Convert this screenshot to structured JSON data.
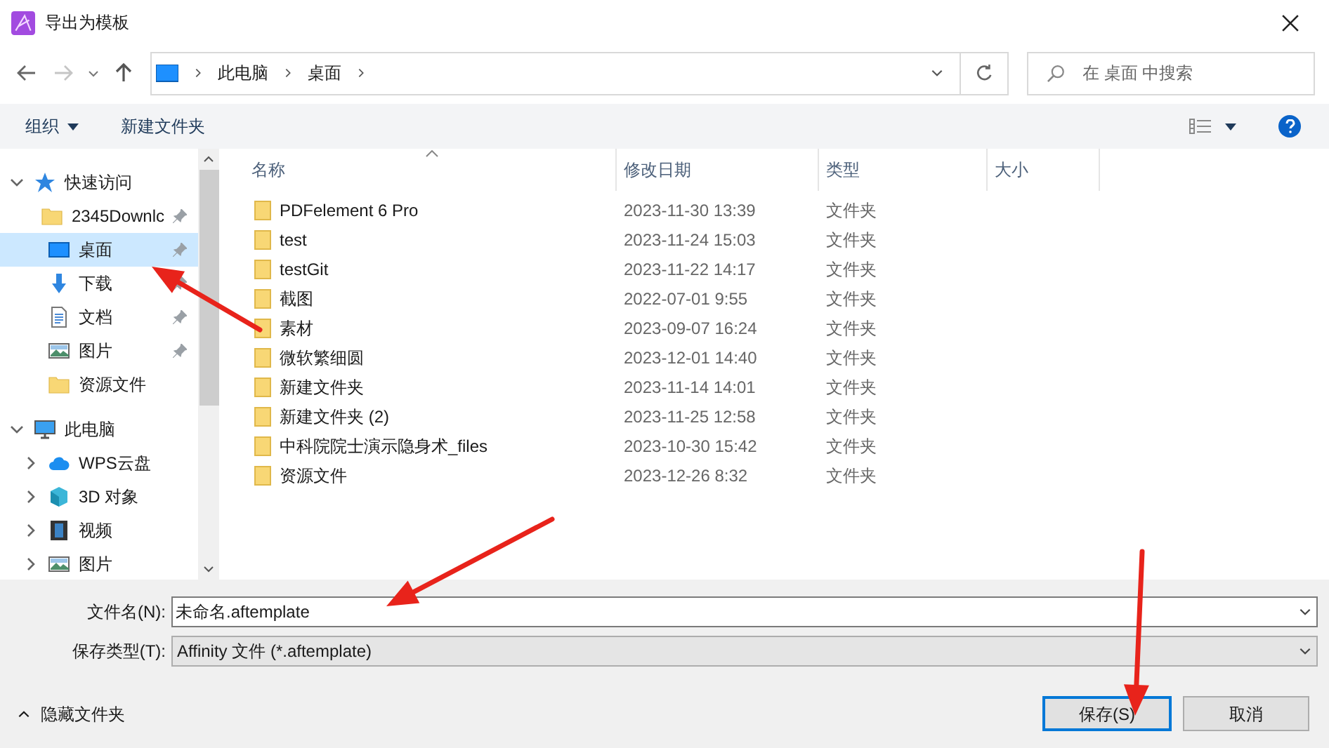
{
  "window": {
    "title": "导出为模板"
  },
  "address": {
    "crumbs": [
      "此电脑",
      "桌面"
    ]
  },
  "search": {
    "placeholder": "在 桌面 中搜索"
  },
  "toolbar": {
    "organize": "组织",
    "new_folder": "新建文件夹"
  },
  "sidebar": {
    "items": [
      {
        "label": "快速访问",
        "kind": "star",
        "expanded": true,
        "selected": false,
        "children": [
          {
            "label": "2345Downlc",
            "kind": "folder",
            "pinned": true,
            "selected": false
          },
          {
            "label": "桌面",
            "kind": "desktop",
            "pinned": true,
            "selected": true
          },
          {
            "label": "下载",
            "kind": "download",
            "pinned": true,
            "selected": false
          },
          {
            "label": "文档",
            "kind": "document",
            "pinned": true,
            "selected": false
          },
          {
            "label": "图片",
            "kind": "picture",
            "pinned": true,
            "selected": false
          },
          {
            "label": "资源文件",
            "kind": "folder",
            "pinned": false,
            "selected": false
          }
        ]
      },
      {
        "label": "此电脑",
        "kind": "computer",
        "expanded": true,
        "selected": false,
        "children": [
          {
            "label": "WPS云盘",
            "kind": "cloud",
            "expanded": false,
            "selected": false
          },
          {
            "label": "3D 对象",
            "kind": "cube",
            "expanded": false,
            "selected": false
          },
          {
            "label": "视频",
            "kind": "video",
            "expanded": false,
            "selected": false
          },
          {
            "label": "图片",
            "kind": "picture",
            "expanded": false,
            "selected": false
          }
        ]
      }
    ]
  },
  "table": {
    "columns": [
      "名称",
      "修改日期",
      "类型",
      "大小"
    ],
    "rows": [
      {
        "name": "PDFelement 6 Pro",
        "date": "2023-11-30 13:39",
        "type": "文件夹"
      },
      {
        "name": "test",
        "date": "2023-11-24 15:03",
        "type": "文件夹"
      },
      {
        "name": "testGit",
        "date": "2023-11-22 14:17",
        "type": "文件夹"
      },
      {
        "name": "截图",
        "date": "2022-07-01 9:55",
        "type": "文件夹"
      },
      {
        "name": "素材",
        "date": "2023-09-07 16:24",
        "type": "文件夹"
      },
      {
        "name": "微软繁细圆",
        "date": "2023-12-01 14:40",
        "type": "文件夹"
      },
      {
        "name": "新建文件夹",
        "date": "2023-11-14 14:01",
        "type": "文件夹"
      },
      {
        "name": "新建文件夹 (2)",
        "date": "2023-11-25 12:58",
        "type": "文件夹"
      },
      {
        "name": "中科院院士演示隐身术_files",
        "date": "2023-10-30 15:42",
        "type": "文件夹"
      },
      {
        "name": "资源文件",
        "date": "2023-12-26 8:32",
        "type": "文件夹"
      }
    ]
  },
  "form": {
    "filename_label": "文件名(N):",
    "filename": "未命名.aftemplate",
    "type_label": "保存类型(T):",
    "type": "Affinity 文件 (*.aftemplate)"
  },
  "footer": {
    "hide_folders": "隐藏文件夹",
    "save": "保存(S)",
    "cancel": "取消"
  }
}
